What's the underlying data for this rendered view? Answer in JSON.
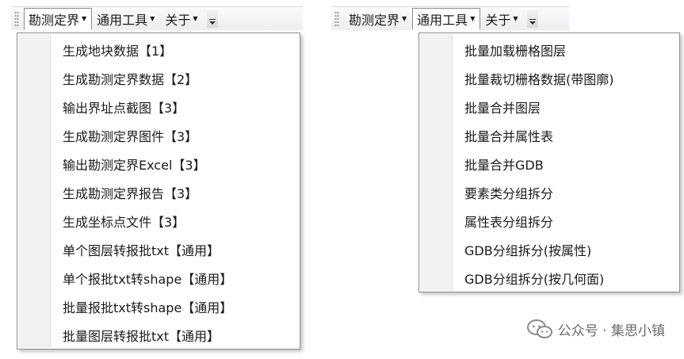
{
  "left_toolbar": {
    "menus": [
      {
        "label": "勘测定界"
      },
      {
        "label": "通用工具"
      },
      {
        "label": "关于"
      }
    ],
    "dropdown_items": [
      "生成地块数据【1】",
      "生成勘测定界数据【2】",
      "输出界址点截图【3】",
      "生成勘测定界图件【3】",
      "输出勘测定界Excel【3】",
      "生成勘测定界报告【3】",
      "生成坐标点文件【3】",
      "单个图层转报批txt【通用】",
      "单个报批txt转shape【通用】",
      "批量报批txt转shape【通用】",
      "批量图层转报批txt【通用】"
    ]
  },
  "right_toolbar": {
    "menus": [
      {
        "label": "勘测定界"
      },
      {
        "label": "通用工具"
      },
      {
        "label": "关于"
      }
    ],
    "dropdown_items": [
      "批量加载栅格图层",
      "批量裁切栅格数据(带图廓)",
      "批量合并图层",
      "批量合并属性表",
      "批量合并GDB",
      "要素类分组拆分",
      "属性表分组拆分",
      "GDB分组拆分(按属性)",
      "GDB分组拆分(按几何面)"
    ]
  },
  "watermark": {
    "text": "公众号 · 集思小镇",
    "icon": "wechat-icon"
  }
}
